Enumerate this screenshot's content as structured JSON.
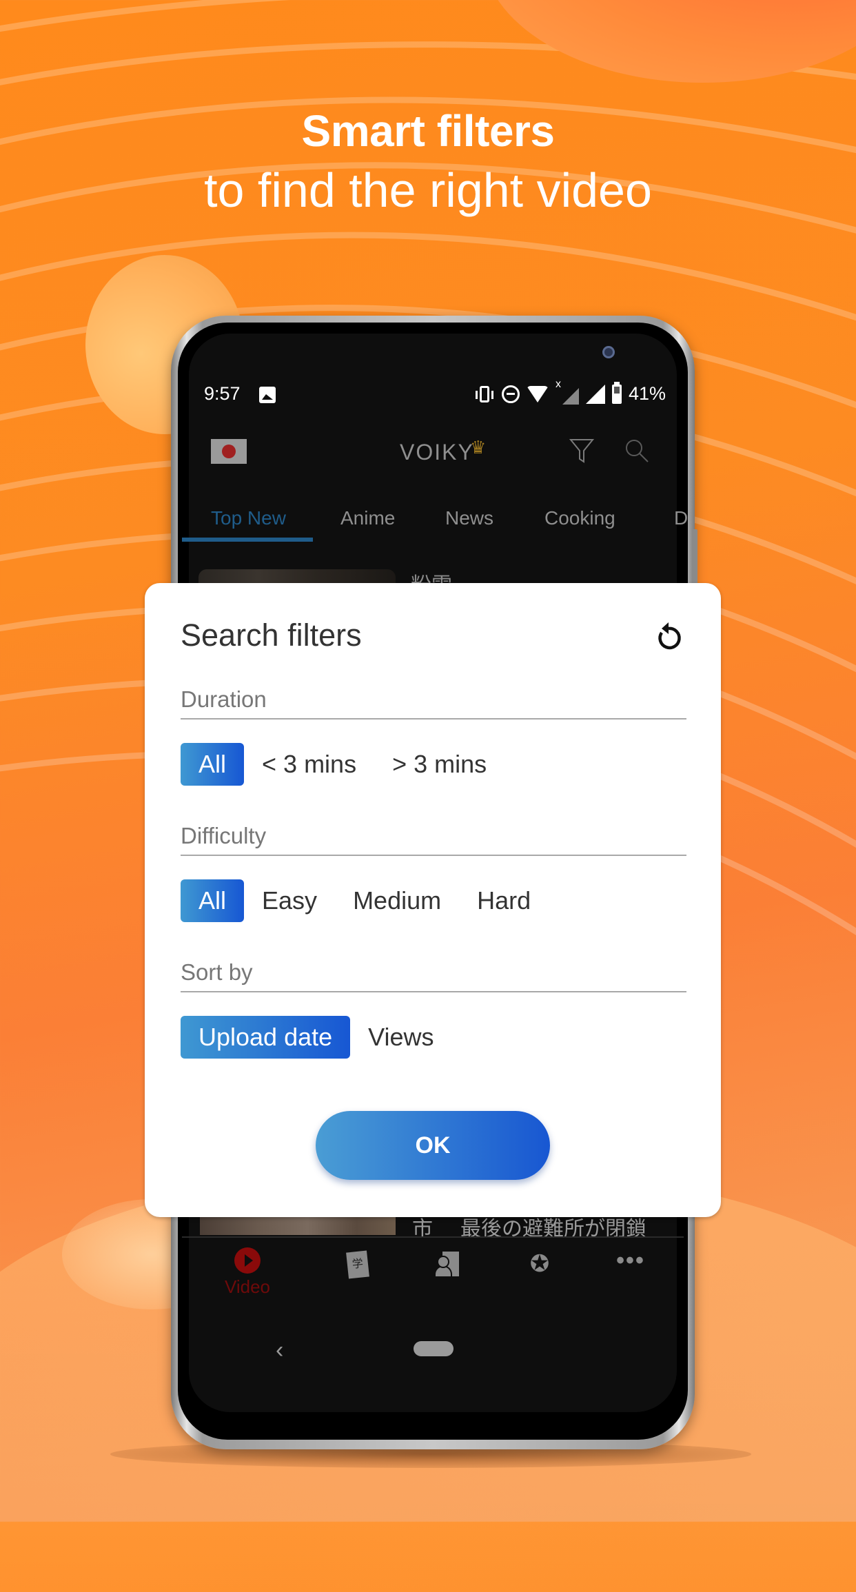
{
  "promo": {
    "headline": "Smart filters",
    "subheadline": "to find the right video"
  },
  "status_bar": {
    "time": "9:57",
    "battery": "41%",
    "icons": [
      "image-icon",
      "vibrate-icon",
      "do-not-disturb-icon",
      "wifi-icon",
      "no-sim-signal-icon",
      "cell-signal-icon",
      "battery-icon"
    ]
  },
  "app_bar": {
    "logo": "VOIKY",
    "crown_icon": "♛",
    "flag": "Japan"
  },
  "tabs": [
    {
      "label": "Top New",
      "active": true
    },
    {
      "label": "Anime",
      "active": false
    },
    {
      "label": "News",
      "active": false
    },
    {
      "label": "Cooking",
      "active": false
    },
    {
      "label": "D",
      "active": false
    }
  ],
  "list": {
    "item1_title_fragment": "粉雪",
    "item2_title_fragment_a": "市",
    "item2_title_fragment_b": "最後の避難所が閉鎖"
  },
  "bottom_nav": {
    "items": [
      {
        "label": "Video",
        "icon": "play-icon",
        "active": true
      },
      {
        "label": "",
        "icon": "study-book-icon",
        "glyph": "学"
      },
      {
        "label": "",
        "icon": "profile-card-icon"
      },
      {
        "label": "",
        "icon": "award-icon",
        "glyph": "✪"
      },
      {
        "label": "",
        "icon": "more-icon",
        "glyph": "•••"
      }
    ]
  },
  "system_nav": {
    "back_glyph": "‹"
  },
  "dialog": {
    "title": "Search filters",
    "sections": [
      {
        "label": "Duration",
        "options": [
          "All",
          "< 3 mins",
          "> 3 mins"
        ],
        "selected": "All"
      },
      {
        "label": "Difficulty",
        "options": [
          "All",
          "Easy",
          "Medium",
          "Hard"
        ],
        "selected": "All"
      },
      {
        "label": "Sort by",
        "options": [
          "Upload date",
          "Views"
        ],
        "selected": "Upload date"
      }
    ],
    "ok_label": "OK"
  },
  "colors": {
    "background_orange": "#fd8b22",
    "chip_gradient_start": "#3f98d2",
    "chip_gradient_end": "#1757d3",
    "tab_active": "#1f5c8a",
    "video_nav_active": "#8a0a0a"
  }
}
